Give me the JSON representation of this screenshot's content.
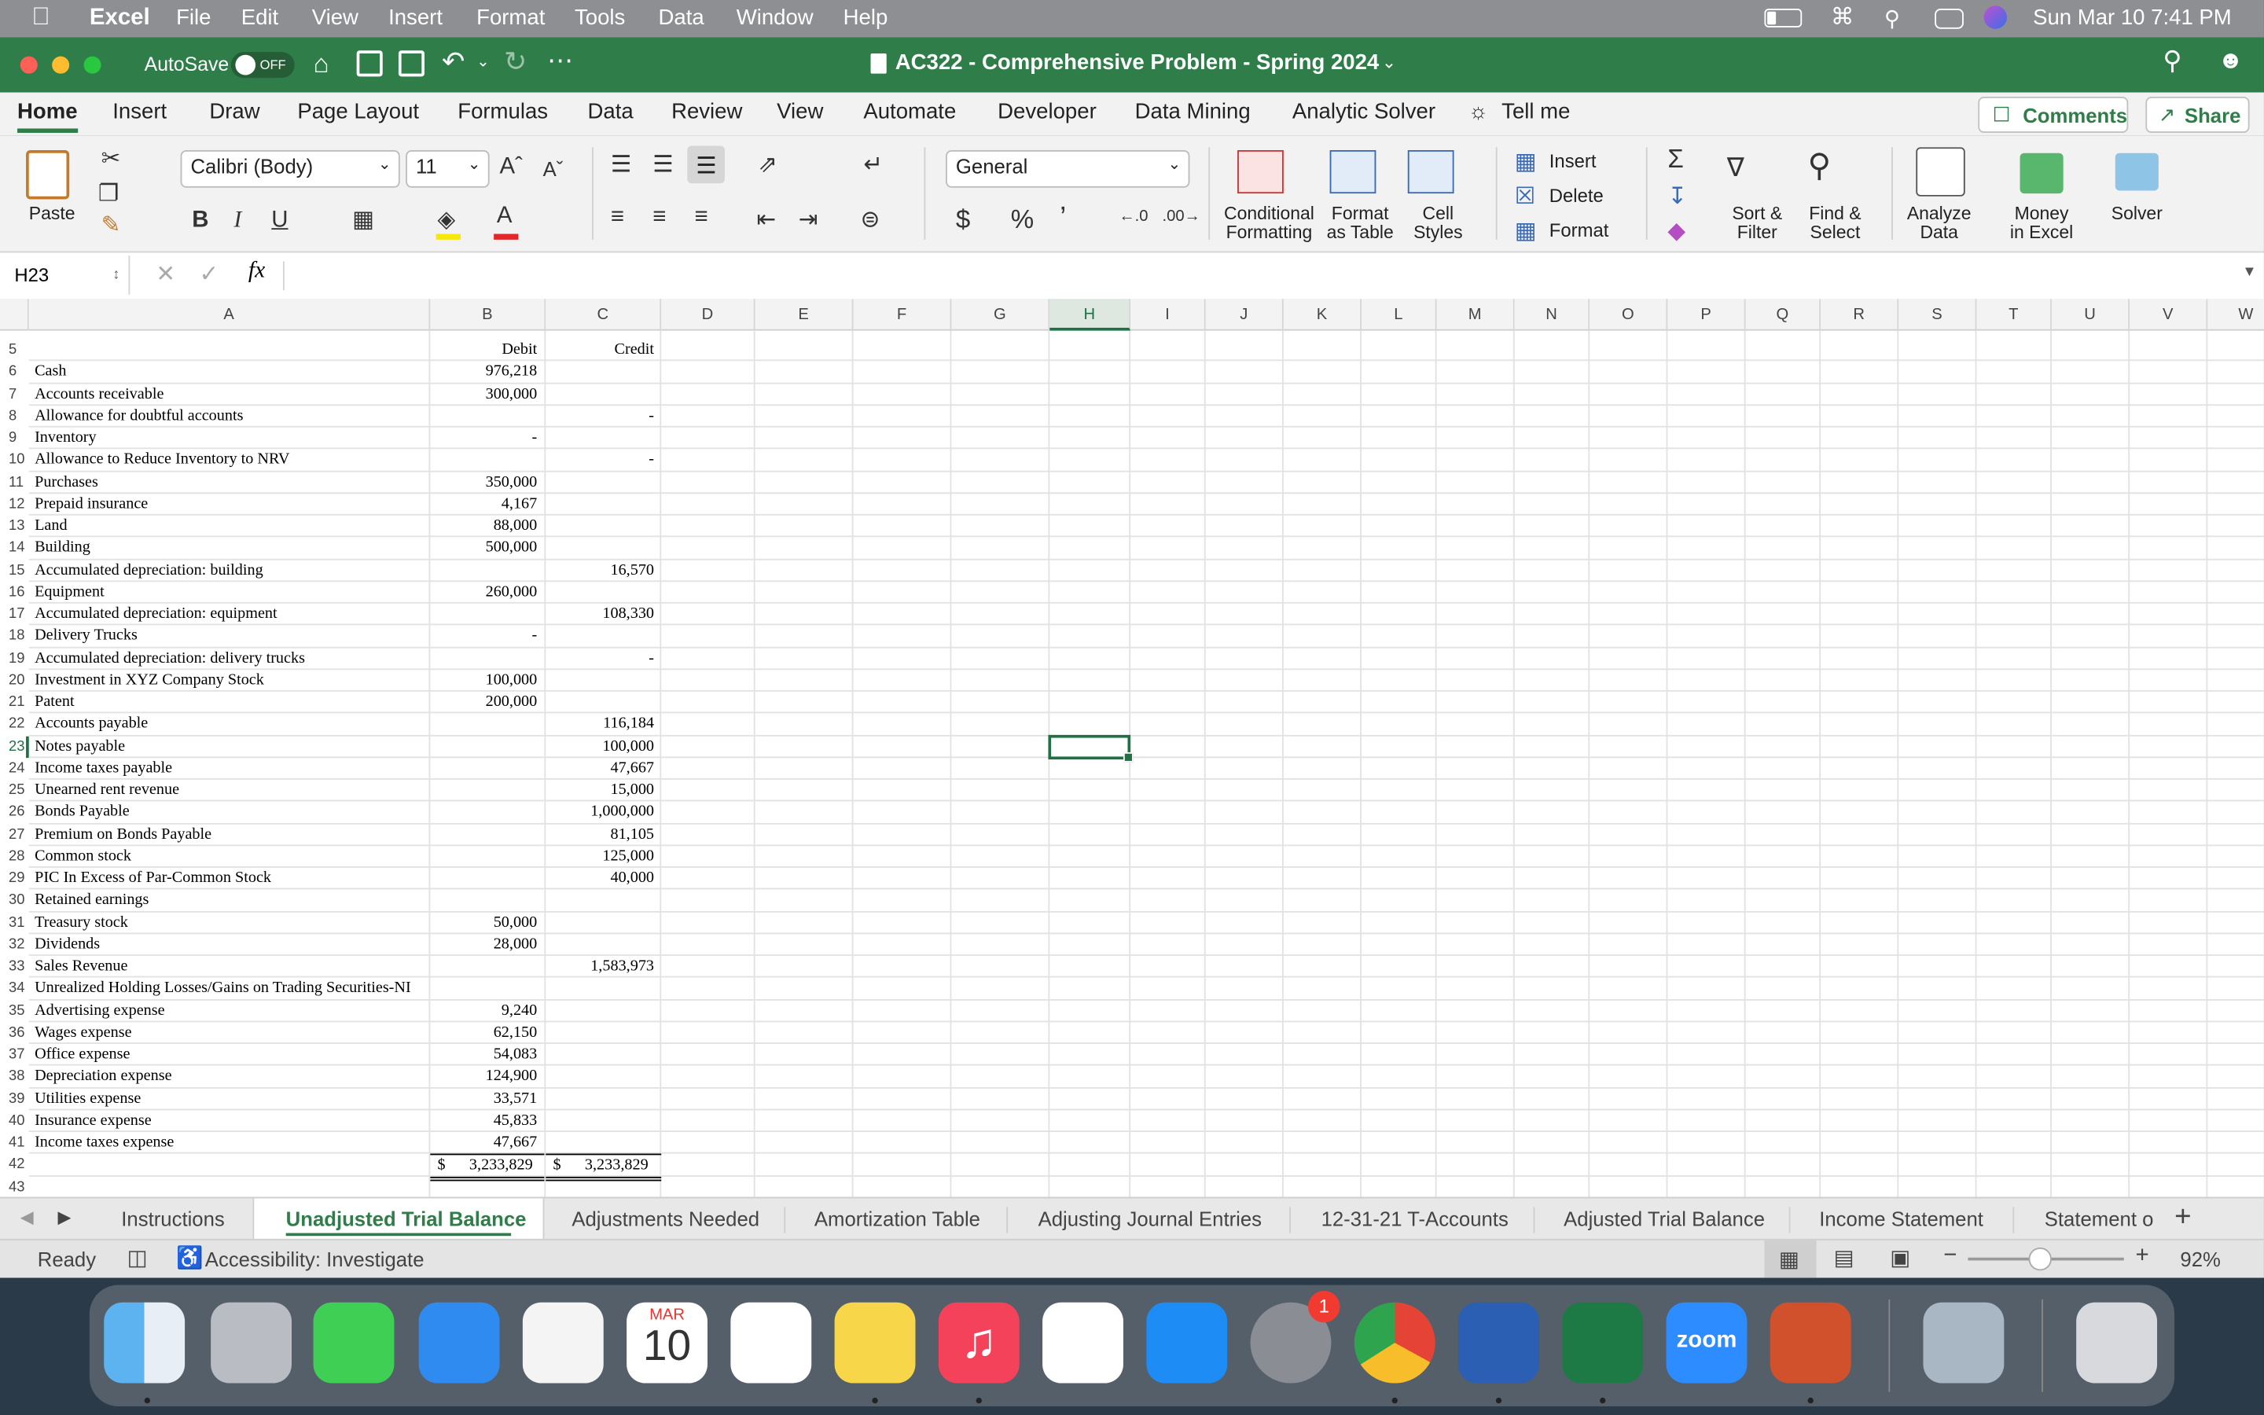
{
  "menubar": {
    "app": "Excel",
    "items": [
      "File",
      "Edit",
      "View",
      "Insert",
      "Format",
      "Tools",
      "Data",
      "Window",
      "Help"
    ],
    "datetime": "Sun Mar 10  7:41 PM"
  },
  "titlebar": {
    "autosave_label": "AutoSave",
    "autosave_state": "OFF",
    "title": "AC322 - Comprehensive Problem - Spring 2024"
  },
  "ribbon_tabs": {
    "items": [
      "Home",
      "Insert",
      "Draw",
      "Page Layout",
      "Formulas",
      "Data",
      "Review",
      "View",
      "Automate",
      "Developer",
      "Data Mining",
      "Analytic Solver"
    ],
    "tell_me": "Tell me",
    "comments": "Comments",
    "share": "Share"
  },
  "ribbon": {
    "paste": "Paste",
    "font_name": "Calibri (Body)",
    "font_size": "11",
    "number_format": "General",
    "conditional_formatting": "Conditional\nFormatting",
    "format_as_table": "Format\nas Table",
    "cell_styles": "Cell\nStyles",
    "insert": "Insert",
    "delete": "Delete",
    "format": "Format",
    "sort_filter": "Sort &\nFilter",
    "find_select": "Find &\nSelect",
    "analyze_data": "Analyze\nData",
    "money_in_excel": "Money\nin Excel",
    "solver": "Solver"
  },
  "formula_bar": {
    "name_box": "H23",
    "fx": "fx",
    "formula": ""
  },
  "columns": [
    "A",
    "B",
    "C",
    "D",
    "E",
    "F",
    "G",
    "H",
    "I",
    "J",
    "K",
    "L",
    "M",
    "N",
    "O",
    "P",
    "Q",
    "R",
    "S",
    "T",
    "U",
    "V",
    "W"
  ],
  "selected_cell": "H23",
  "rows": [
    {
      "n": "5",
      "a": "",
      "b": "Debit",
      "c": "Credit"
    },
    {
      "n": "6",
      "a": "Cash",
      "b": "976,218",
      "c": ""
    },
    {
      "n": "7",
      "a": "Accounts receivable",
      "b": "300,000",
      "c": ""
    },
    {
      "n": "8",
      "a": "Allowance for doubtful accounts",
      "b": "",
      "c": "-"
    },
    {
      "n": "9",
      "a": "Inventory",
      "b": "-",
      "c": ""
    },
    {
      "n": "10",
      "a": "Allowance to Reduce Inventory to NRV",
      "b": "",
      "c": "-"
    },
    {
      "n": "11",
      "a": "Purchases",
      "b": "350,000",
      "c": ""
    },
    {
      "n": "12",
      "a": "Prepaid insurance",
      "b": "4,167",
      "c": ""
    },
    {
      "n": "13",
      "a": "Land",
      "b": "88,000",
      "c": ""
    },
    {
      "n": "14",
      "a": "Building",
      "b": "500,000",
      "c": ""
    },
    {
      "n": "15",
      "a": "Accumulated depreciation: building",
      "b": "",
      "c": "16,570"
    },
    {
      "n": "16",
      "a": "Equipment",
      "b": "260,000",
      "c": ""
    },
    {
      "n": "17",
      "a": "Accumulated depreciation: equipment",
      "b": "",
      "c": "108,330"
    },
    {
      "n": "18",
      "a": "Delivery Trucks",
      "b": "-",
      "c": ""
    },
    {
      "n": "19",
      "a": "Accumulated depreciation: delivery trucks",
      "b": "",
      "c": "-"
    },
    {
      "n": "20",
      "a": "Investment in XYZ Company Stock",
      "b": "100,000",
      "c": ""
    },
    {
      "n": "21",
      "a": "Patent",
      "b": "200,000",
      "c": ""
    },
    {
      "n": "22",
      "a": "Accounts payable",
      "b": "",
      "c": "116,184"
    },
    {
      "n": "23",
      "a": "Notes payable",
      "b": "",
      "c": "100,000"
    },
    {
      "n": "24",
      "a": "Income taxes payable",
      "b": "",
      "c": "47,667"
    },
    {
      "n": "25",
      "a": "Unearned rent revenue",
      "b": "",
      "c": "15,000"
    },
    {
      "n": "26",
      "a": "Bonds Payable",
      "b": "",
      "c": "1,000,000"
    },
    {
      "n": "27",
      "a": "Premium on Bonds Payable",
      "b": "",
      "c": "81,105"
    },
    {
      "n": "28",
      "a": "Common stock",
      "b": "",
      "c": "125,000"
    },
    {
      "n": "29",
      "a": "PIC In Excess of Par-Common Stock",
      "b": "",
      "c": "40,000"
    },
    {
      "n": "30",
      "a": "Retained earnings",
      "b": "",
      "c": ""
    },
    {
      "n": "31",
      "a": "Treasury stock",
      "b": "50,000",
      "c": ""
    },
    {
      "n": "32",
      "a": "Dividends",
      "b": "28,000",
      "c": ""
    },
    {
      "n": "33",
      "a": "Sales Revenue",
      "b": "",
      "c": "1,583,973"
    },
    {
      "n": "34",
      "a": "Unrealized Holding Losses/Gains on Trading Securities-NI",
      "b": "",
      "c": ""
    },
    {
      "n": "35",
      "a": "Advertising expense",
      "b": "9,240",
      "c": ""
    },
    {
      "n": "36",
      "a": "Wages expense",
      "b": "62,150",
      "c": ""
    },
    {
      "n": "37",
      "a": "Office expense",
      "b": "54,083",
      "c": ""
    },
    {
      "n": "38",
      "a": "Depreciation expense",
      "b": "124,900",
      "c": ""
    },
    {
      "n": "39",
      "a": "Utilities expense",
      "b": "33,571",
      "c": ""
    },
    {
      "n": "40",
      "a": "Insurance expense",
      "b": "45,833",
      "c": ""
    },
    {
      "n": "41",
      "a": "Income taxes expense",
      "b": "47,667",
      "c": ""
    },
    {
      "n": "42",
      "a": "",
      "b": "$      3,233,829",
      "c": "$      3,233,829"
    },
    {
      "n": "43",
      "a": "",
      "b": "",
      "c": ""
    }
  ],
  "sheet_tabs": {
    "items": [
      "Instructions",
      "Unadjusted Trial Balance",
      "Adjustments Needed",
      "Amortization Table",
      "Adjusting Journal Entries",
      "12-31-21 T-Accounts",
      "Adjusted Trial Balance",
      "Income Statement",
      "Statement o"
    ],
    "active": "Unadjusted Trial Balance"
  },
  "status_bar": {
    "mode": "Ready",
    "accessibility": "Accessibility: Investigate",
    "zoom": "92%"
  },
  "dock": {
    "calendar_month": "MAR",
    "calendar_day": "10",
    "settings_badge": "1",
    "zoom_label": "zoom"
  },
  "colors": {
    "excel_green": "#2f7d48",
    "selection": "#1f7145"
  }
}
